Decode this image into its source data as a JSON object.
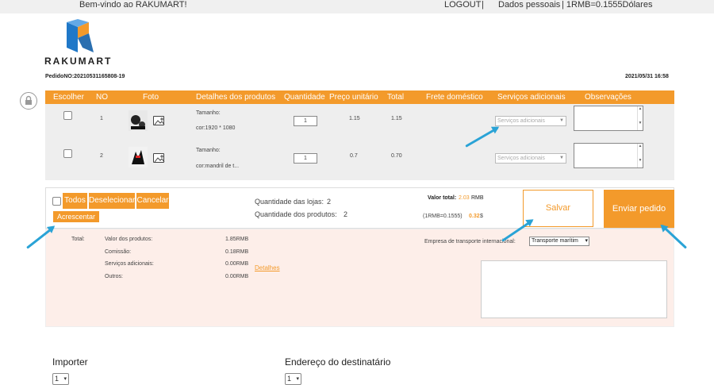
{
  "topbar": {
    "welcome": "Bem-vindo ao RAKUMART!",
    "logout": "LOGOUT",
    "separator": "|",
    "personal": "Dados pessoais",
    "rate": "| 1RMB=0.1555Dólares"
  },
  "brand": {
    "name": "RAKUMART"
  },
  "order": {
    "number": "PedidoNO:20210531165808-19",
    "date": "2021/05/31 16:58"
  },
  "table": {
    "headers": [
      "Escolher",
      "NO",
      "Foto",
      "Detalhes dos produtos",
      "Quantidade",
      "Preço unitário",
      "Total",
      "Frete doméstico",
      "Serviços adicionais",
      "Observações"
    ],
    "rows": [
      {
        "no": "1",
        "detail_line1": "Tamanho:",
        "detail_line2": "cor:1920 * 1080",
        "qty": "1",
        "price": "1.15",
        "total": "1.15",
        "service_placeholder": "Serviços adicionais"
      },
      {
        "no": "2",
        "detail_line1": "Tamanho:",
        "detail_line2": "cor:mandril de t...",
        "qty": "1",
        "price": "0.7",
        "total": "0.70",
        "service_placeholder": "Serviços adicionais"
      }
    ]
  },
  "actions": {
    "all": "Todos",
    "deselect": "Deselecionar",
    "cancel": "Cancelar",
    "add": "Acrescentar",
    "stores_label": "Quantidade das lojas:",
    "stores_value": "2",
    "products_label": "Quantidade  dos produtos:",
    "products_value": "2",
    "total_label": "Valor total:",
    "total_value": "2.03",
    "total_unit": "RMB",
    "rate_label": "(1RMB=0.1555)",
    "usd_value": "0.32",
    "usd_unit": "$",
    "save": "Salvar",
    "submit": "Enviar pedido"
  },
  "summary": {
    "total_label": "Total:",
    "rows": [
      {
        "label": "Valor dos produtos:",
        "value": "1.85RMB"
      },
      {
        "label": "Comissão:",
        "value": "0.18RMB"
      },
      {
        "label": "Serviços adicionais:",
        "value": "0.00RMB"
      },
      {
        "label": "Outros:",
        "value": "0.00RMB"
      }
    ],
    "details_link": "Detalhes",
    "shipping_label": "Empresa de transporte internacional:",
    "shipping_value": "Transporte marítim"
  },
  "bottom": {
    "importer_label": "Importer",
    "importer_value": "1",
    "address_label": "Endereço do destinatário",
    "address_value": "1"
  },
  "colors": {
    "accent": "#f39a2b",
    "arrow": "#2aa3d6",
    "summary_bg": "#fdeee9",
    "price_orange": "#f39a2b"
  }
}
